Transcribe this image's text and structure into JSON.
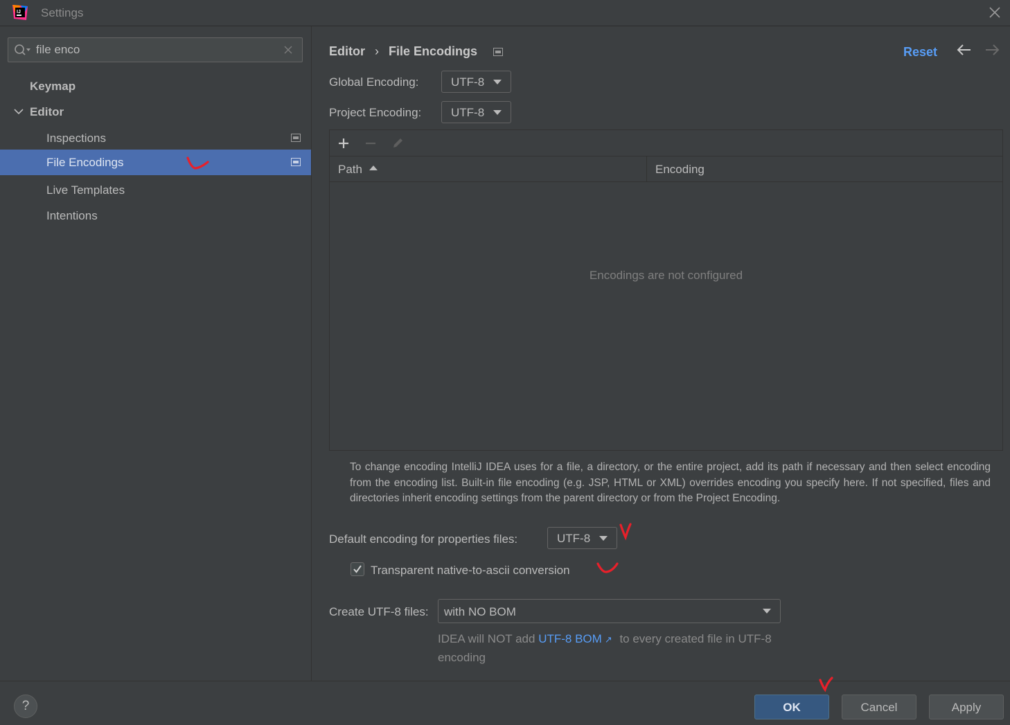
{
  "window": {
    "title": "Settings"
  },
  "search": {
    "value": "file enco"
  },
  "sidebar": {
    "items": [
      {
        "label": "Keymap"
      },
      {
        "label": "Editor"
      },
      {
        "label": "Inspections"
      },
      {
        "label": "File Encodings"
      },
      {
        "label": "Live Templates"
      },
      {
        "label": "Intentions"
      }
    ]
  },
  "header": {
    "breadcrumb_parent": "Editor",
    "breadcrumb_current": "File Encodings",
    "reset_label": "Reset"
  },
  "encodings": {
    "global_label": "Global Encoding:",
    "global_value": "UTF-8",
    "project_label": "Project Encoding:",
    "project_value": "UTF-8"
  },
  "table": {
    "columns": [
      "Path",
      "Encoding"
    ],
    "empty_text": "Encodings are not configured"
  },
  "help_text": "To change encoding IntelliJ IDEA uses for a file, a directory, or the entire project, add its path if necessary and then select encoding from the encoding list. Built-in file encoding (e.g. JSP, HTML or XML) overrides encoding you specify here. If not specified, files and directories inherit encoding settings from the parent directory or from the Project Encoding.",
  "properties": {
    "label": "Default encoding for properties files:",
    "value": "UTF-8",
    "transparent_label": "Transparent native-to-ascii conversion",
    "transparent_checked": true
  },
  "utf8": {
    "label": "Create UTF-8 files:",
    "value": "with NO BOM",
    "note_prefix": "IDEA will NOT add",
    "note_link": "UTF-8 BOM",
    "note_link_arrow": "↗",
    "note_suffix": "to every created file in UTF-8",
    "note_line2": "encoding"
  },
  "buttons": {
    "help": "?",
    "ok": "OK",
    "cancel": "Cancel",
    "apply": "Apply"
  },
  "colors": {
    "selection": "#4b6eaf",
    "link": "#589df6",
    "annotation": "#e8202a"
  }
}
